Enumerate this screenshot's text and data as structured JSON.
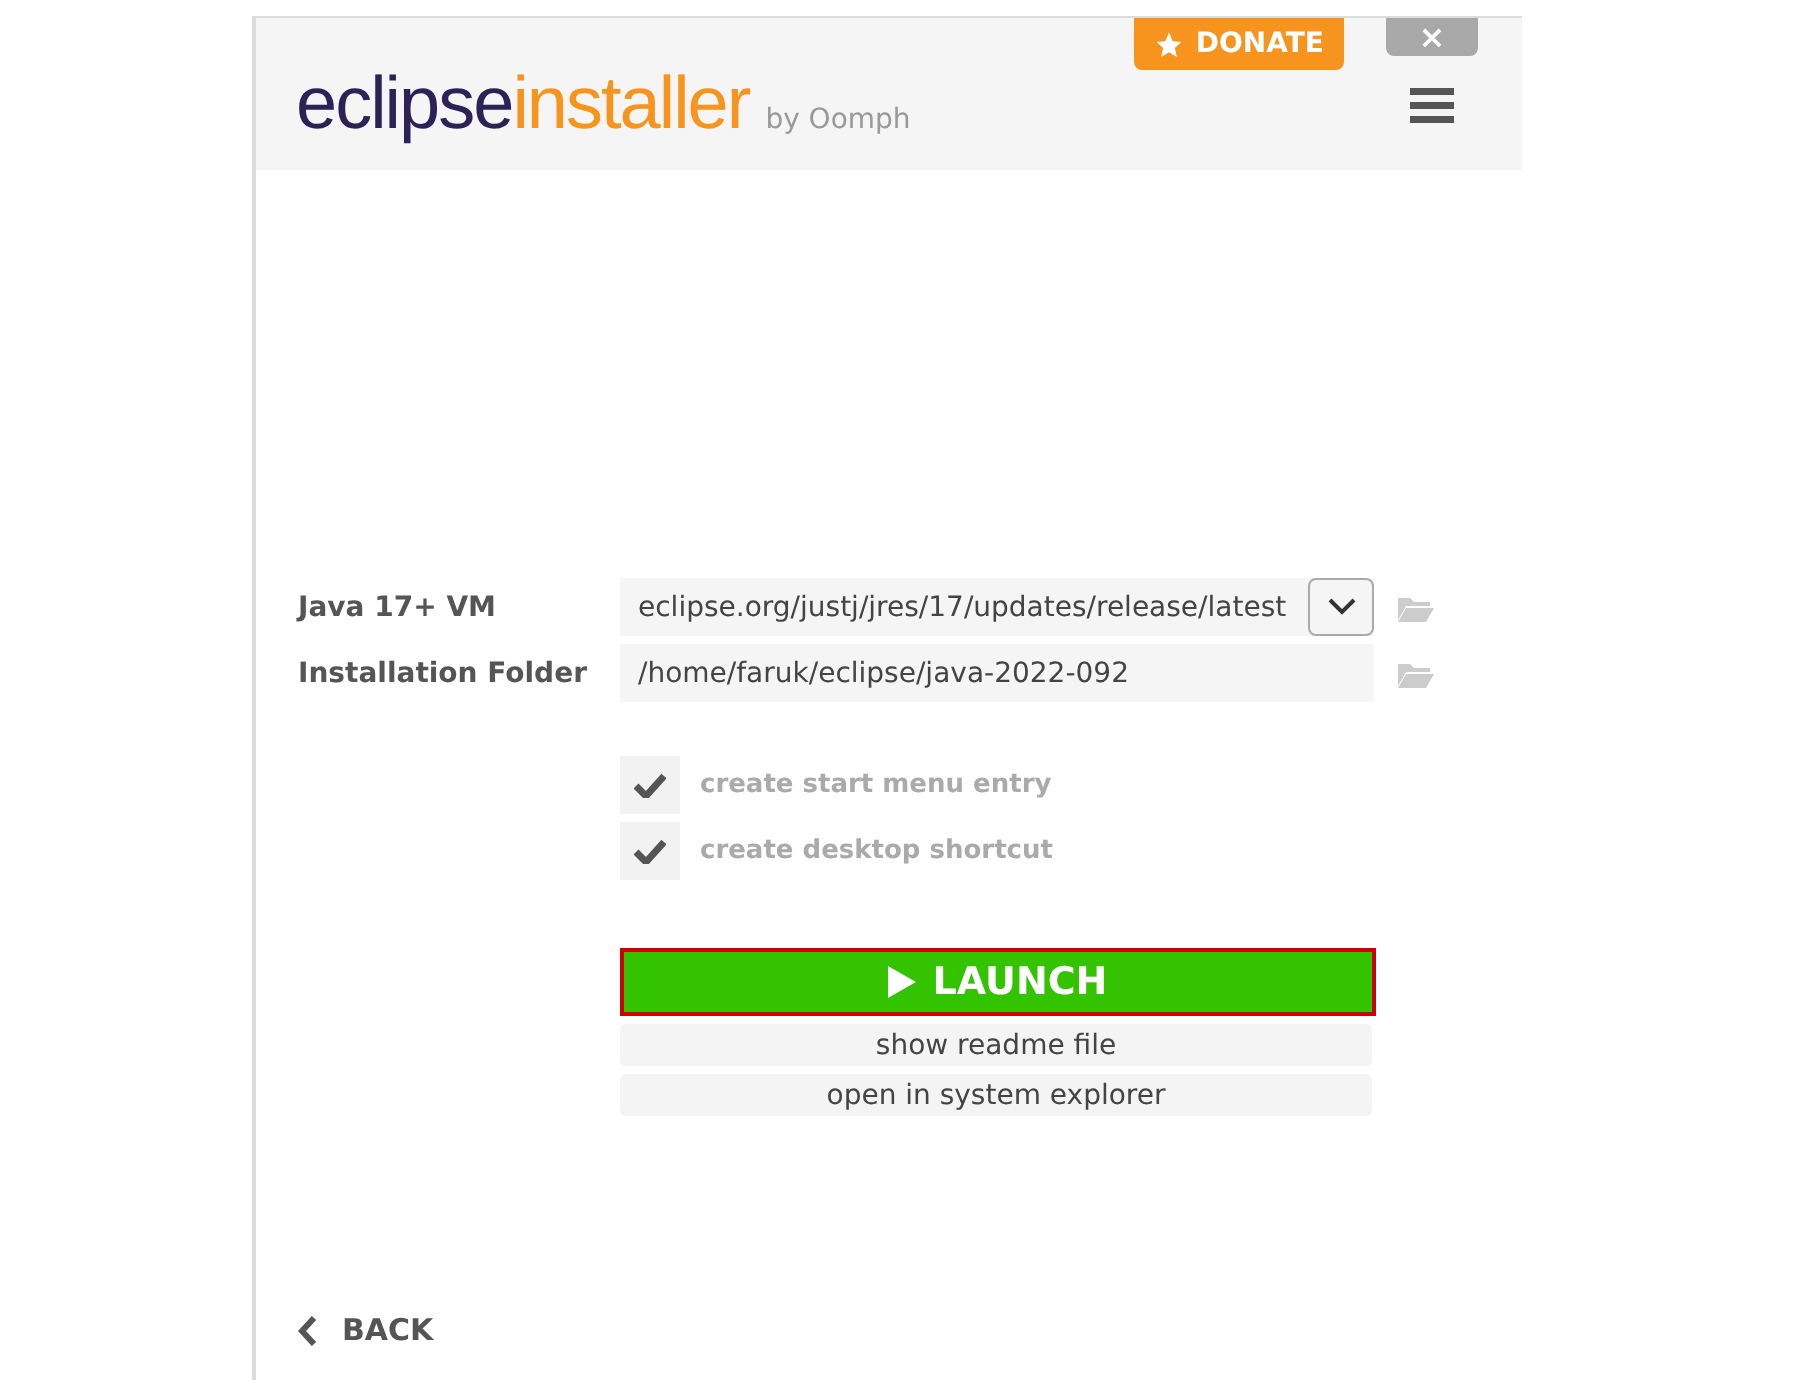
{
  "header": {
    "logo_primary": "eclipse",
    "logo_secondary": "installer",
    "byline": "by Oomph",
    "donate": "DONATE",
    "close": "×"
  },
  "fields": [
    {
      "kind": "dropdown",
      "label": "Java 17+ VM",
      "value": "eclipse.org/justj/jres/17/updates/release/latest"
    },
    {
      "kind": "text",
      "label": "Installation Folder",
      "value": "/home/faruk/eclipse/java-2022-092"
    }
  ],
  "options": [
    {
      "label": "create start menu entry",
      "checked": true,
      "disabled": true
    },
    {
      "label": "create desktop shortcut",
      "checked": true,
      "disabled": true
    }
  ],
  "launch": {
    "label": "LAUNCH"
  },
  "links": [
    "show readme file",
    "open in system explorer"
  ],
  "back": "BACK"
}
